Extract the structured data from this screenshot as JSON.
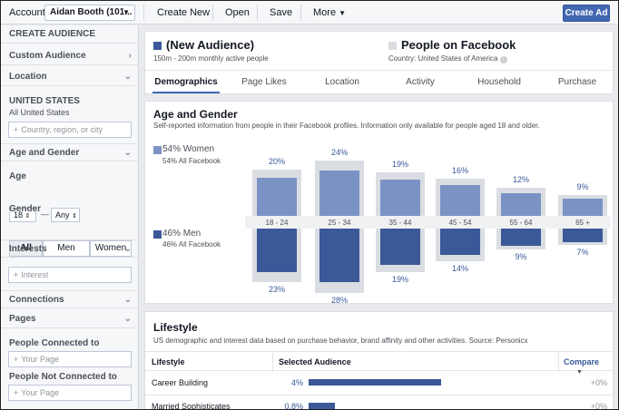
{
  "topbar": {
    "account_label": "Account:",
    "account_value": "Aidan Booth (101...",
    "create_new": "Create New",
    "open": "Open",
    "save": "Save",
    "more": "More",
    "create_ad": "Create Ad"
  },
  "sidebar": {
    "title": "CREATE AUDIENCE",
    "custom_audience": "Custom Audience",
    "location": "Location",
    "country": "UNITED STATES",
    "all_us": "All United States",
    "location_placeholder": "Country, region, or city",
    "age_gender": "Age and Gender",
    "age_label": "Age",
    "age_min": "18",
    "age_dash": "—",
    "age_max": "Any",
    "gender_label": "Gender",
    "gender_all": "All",
    "gender_men": "Men",
    "gender_women": "Women",
    "interests": "Interests",
    "interest_placeholder": "Interest",
    "connections": "Connections",
    "pages": "Pages",
    "people_connected": "People Connected to",
    "your_page_1": "Your Page",
    "people_not_connected": "People Not Connected to",
    "your_page_2": "Your Page"
  },
  "header": {
    "audience_title": "(New Audience)",
    "audience_sub": "150m - 200m monthly active people",
    "facebook_title": "People on Facebook",
    "facebook_sub": "Country: United States of America",
    "audience_color": "#3b5998",
    "facebook_color": "#dadde1",
    "tabs": [
      "Demographics",
      "Page Likes",
      "Location",
      "Activity",
      "Household",
      "Purchase"
    ]
  },
  "age_gender_card": {
    "title": "Age and Gender",
    "description": "Self-reported information from people in their Facebook profiles. Information only available for people aged 18 and older.",
    "women_label": "54% Women",
    "women_sub": "54% All Facebook",
    "men_label": "46% Men",
    "men_sub": "46% All Facebook"
  },
  "chart_data": {
    "type": "bar",
    "categories": [
      "18 - 24",
      "25 - 34",
      "35 - 44",
      "45 - 54",
      "55 - 64",
      "65 +"
    ],
    "series": [
      {
        "name": "Women",
        "values": [
          20,
          24,
          19,
          16,
          12,
          9
        ],
        "labels": [
          "20%",
          "24%",
          "19%",
          "16%",
          "12%",
          "9%"
        ],
        "color": "#7b93c4"
      },
      {
        "name": "Men",
        "values": [
          23,
          28,
          19,
          14,
          9,
          7
        ],
        "labels": [
          "23%",
          "28%",
          "19%",
          "14%",
          "9%",
          "7%"
        ],
        "color": "#3b5998"
      }
    ]
  },
  "lifestyle": {
    "title": "Lifestyle",
    "description": "US demographic and interest data based on purchase behavior, brand affinity and other activities. Source: Personicx",
    "col_lifestyle": "Lifestyle",
    "col_selected": "Selected Audience",
    "col_compare": "Compare",
    "rows": [
      {
        "name": "Career Building",
        "pct": "4%",
        "value": 4,
        "compare": "+0%"
      },
      {
        "name": "Married Sophisticates",
        "pct": "0.8%",
        "value": 0.8,
        "compare": "+0%"
      }
    ]
  }
}
